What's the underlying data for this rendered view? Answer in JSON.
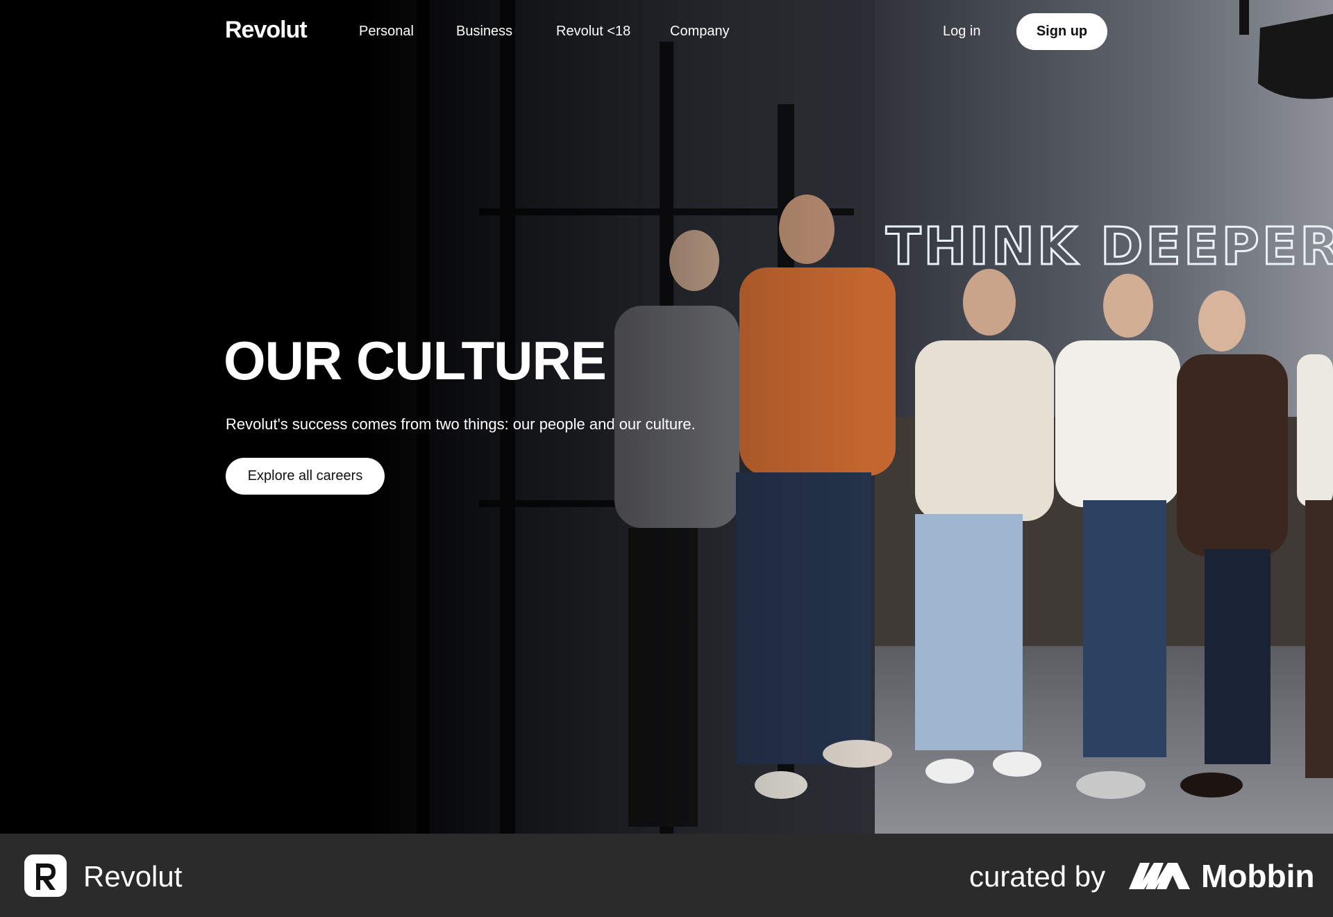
{
  "nav": {
    "logo": "Revolut",
    "links": [
      "Personal",
      "Business",
      "Revolut <18",
      "Company"
    ],
    "login": "Log in",
    "signup": "Sign up"
  },
  "hero": {
    "title": "OUR CULTURE",
    "subtitle": "Revolut's success comes from two things: our people and our culture.",
    "cta": "Explore all careers",
    "neon_sign": "THINK DEEPER"
  },
  "brandbar": {
    "app_name": "Revolut",
    "curated_by": "curated by",
    "curator": "Mobbin"
  },
  "colors": {
    "background": "#000000",
    "brandbar": "#2b2b2b",
    "button": "#ffffff"
  }
}
